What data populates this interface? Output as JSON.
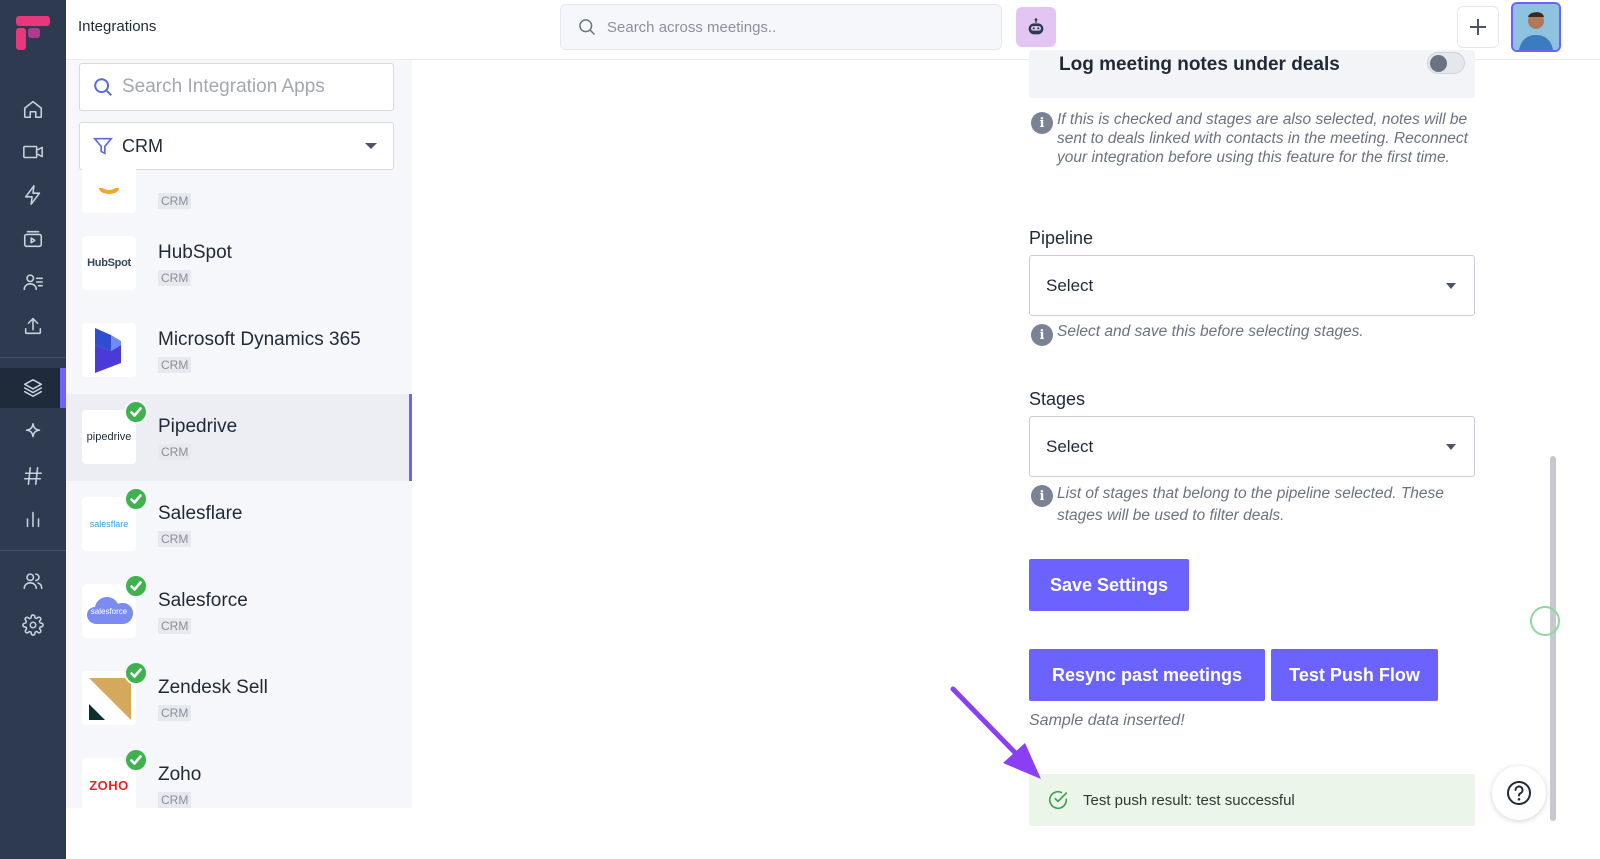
{
  "header": {
    "title": "Integrations",
    "search_placeholder": "Search across meetings.."
  },
  "list": {
    "search_placeholder": "Search Integration Apps",
    "filter_value": "CRM",
    "items": [
      {
        "name": "HubSpot",
        "tag": "CRM",
        "connected": false,
        "logo_text": "HubSpot"
      },
      {
        "name": "Microsoft Dynamics 365",
        "tag": "CRM",
        "connected": false
      },
      {
        "name": "Pipedrive",
        "tag": "CRM",
        "connected": true,
        "selected": true,
        "logo_text": "pipedrive"
      },
      {
        "name": "Salesflare",
        "tag": "CRM",
        "connected": true,
        "logo_text": "salesflare"
      },
      {
        "name": "Salesforce",
        "tag": "CRM",
        "connected": true,
        "logo_text": "salesforce"
      },
      {
        "name": "Zendesk Sell",
        "tag": "CRM",
        "connected": true
      },
      {
        "name": "Zoho",
        "tag": "CRM",
        "connected": true,
        "logo_text": "ZOHO"
      }
    ],
    "partial_top_tag": "CRM"
  },
  "settings": {
    "log_deals_label": "Log meeting notes under deals",
    "log_deals_info": "If this is checked and stages are also selected, notes will be sent to deals linked with contacts in the meeting. Reconnect your integration before using this feature for the first time.",
    "pipeline_label": "Pipeline",
    "pipeline_value": "Select",
    "pipeline_info": "Select and save this before selecting stages.",
    "stages_label": "Stages",
    "stages_value": "Select",
    "stages_info": "List of stages that belong to the pipeline selected. These stages will be used to filter deals.",
    "save_label": "Save Settings",
    "resync_label": "Resync past meetings",
    "test_push_label": "Test Push Flow",
    "sample_text": "Sample data inserted!",
    "result_text": "Test push result: test successful"
  },
  "colors": {
    "accent": "#6c63ff",
    "rail": "#2d3a4f",
    "success": "#3fb24f"
  }
}
